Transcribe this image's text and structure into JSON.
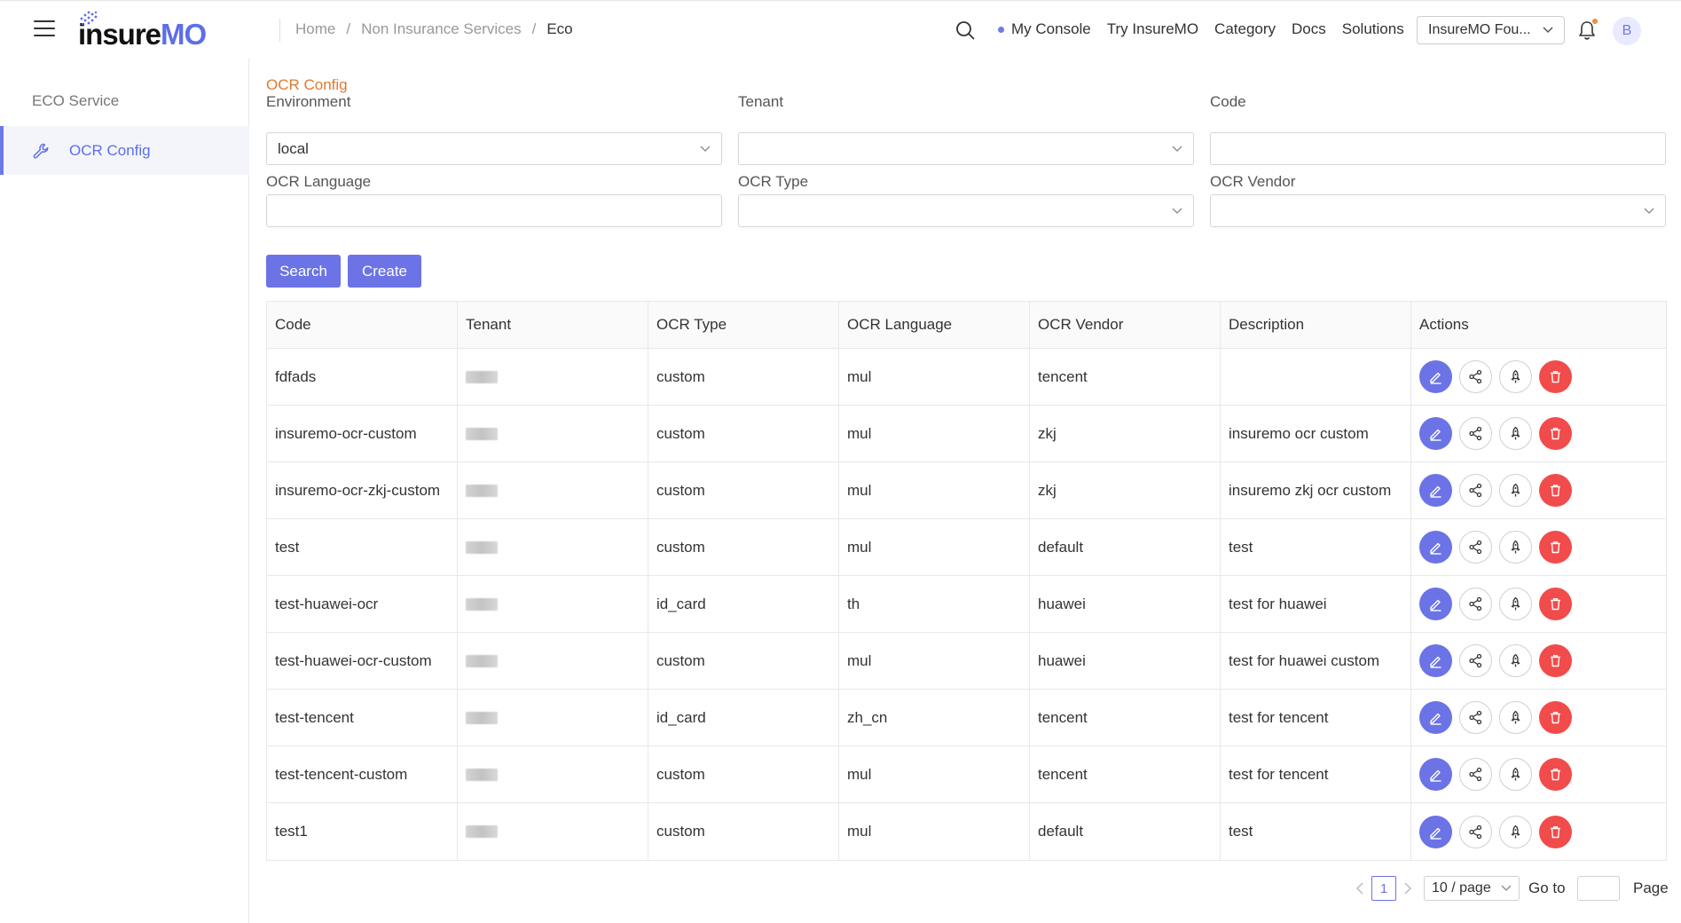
{
  "header": {
    "logo_main": "insure",
    "logo_accent": "MO",
    "breadcrumb": [
      "Home",
      "Non Insurance Services",
      "Eco"
    ],
    "nav": [
      "My Console",
      "Try InsureMO",
      "Category",
      "Docs",
      "Solutions"
    ],
    "org_select": "InsureMO Fou...",
    "avatar": "B"
  },
  "sidebar": {
    "group_title": "ECO Service",
    "items": [
      {
        "label": "OCR Config"
      }
    ]
  },
  "main": {
    "title": "OCR Config",
    "form": {
      "environment_label": "Environment",
      "environment_value": "local",
      "tenant_label": "Tenant",
      "tenant_value": "",
      "code_label": "Code",
      "code_value": "",
      "ocr_language_label": "OCR Language",
      "ocr_language_value": "",
      "ocr_type_label": "OCR Type",
      "ocr_type_value": "",
      "ocr_vendor_label": "OCR Vendor",
      "ocr_vendor_value": ""
    },
    "buttons": {
      "search": "Search",
      "create": "Create"
    },
    "table": {
      "columns": [
        "Code",
        "Tenant",
        "OCR Type",
        "OCR Language",
        "OCR Vendor",
        "Description",
        "Actions"
      ],
      "rows": [
        {
          "code": "fdfads",
          "ocr_type": "custom",
          "ocr_language": "mul",
          "ocr_vendor": "tencent",
          "description": ""
        },
        {
          "code": "insuremo-ocr-custom",
          "ocr_type": "custom",
          "ocr_language": "mul",
          "ocr_vendor": "zkj",
          "description": "insuremo ocr custom"
        },
        {
          "code": "insuremo-ocr-zkj-custom",
          "ocr_type": "custom",
          "ocr_language": "mul",
          "ocr_vendor": "zkj",
          "description": "insuremo zkj ocr custom"
        },
        {
          "code": "test",
          "ocr_type": "custom",
          "ocr_language": "mul",
          "ocr_vendor": "default",
          "description": "test"
        },
        {
          "code": "test-huawei-ocr",
          "ocr_type": "id_card",
          "ocr_language": "th",
          "ocr_vendor": "huawei",
          "description": "test for huawei"
        },
        {
          "code": "test-huawei-ocr-custom",
          "ocr_type": "custom",
          "ocr_language": "mul",
          "ocr_vendor": "huawei",
          "description": "test for huawei custom"
        },
        {
          "code": "test-tencent",
          "ocr_type": "id_card",
          "ocr_language": "zh_cn",
          "ocr_vendor": "tencent",
          "description": "test for tencent"
        },
        {
          "code": "test-tencent-custom",
          "ocr_type": "custom",
          "ocr_language": "mul",
          "ocr_vendor": "tencent",
          "description": "test for tencent"
        },
        {
          "code": "test1",
          "ocr_type": "custom",
          "ocr_language": "mul",
          "ocr_vendor": "default",
          "description": "test"
        }
      ]
    },
    "pagination": {
      "current_page": "1",
      "page_size": "10 / page",
      "goto_label": "Go to",
      "page_label": "Page"
    }
  },
  "colors": {
    "accent": "#6b73e6",
    "title_orange": "#e07a2e",
    "danger": "#f24b4b"
  },
  "icons": [
    "hamburger-icon",
    "search-icon",
    "bell-icon",
    "wrench-icon",
    "chevron-down-icon",
    "edit-icon",
    "share-icon",
    "deploy-icon",
    "delete-icon"
  ]
}
